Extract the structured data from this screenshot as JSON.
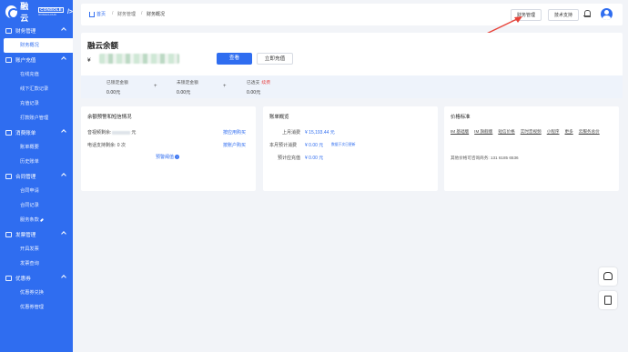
{
  "brand": {
    "name": "融云",
    "console": "CONSOLE",
    "sub": "RONGCLOUD",
    "code": "/>"
  },
  "sidebar": {
    "groups": [
      {
        "label": "财务管理",
        "items": [
          {
            "label": "财务概况",
            "active": true
          }
        ]
      },
      {
        "label": "账户充值",
        "items": [
          {
            "label": "在线充值"
          },
          {
            "label": "线下汇款记录"
          },
          {
            "label": "充值记录"
          },
          {
            "label": "打款账户管理"
          }
        ]
      },
      {
        "label": "消费账单",
        "items": [
          {
            "label": "账单概要"
          },
          {
            "label": "历史账单"
          }
        ]
      },
      {
        "label": "合同管理",
        "items": [
          {
            "label": "合同申请"
          },
          {
            "label": "合同记录"
          },
          {
            "label": "服务条款"
          }
        ]
      },
      {
        "label": "发票管理",
        "items": [
          {
            "label": "开具发票"
          },
          {
            "label": "发票查询"
          }
        ]
      },
      {
        "label": "优惠券",
        "items": [
          {
            "label": "优惠券兑换"
          },
          {
            "label": "优惠券管理"
          }
        ]
      }
    ]
  },
  "header": {
    "home": "首页",
    "sep": "/",
    "crumbs": [
      "财务管理",
      "财务概况"
    ],
    "finance_button": "财务管理",
    "tech_button": "技术支持"
  },
  "balance": {
    "title": "融云余额",
    "currency": "¥",
    "view_button": "查看",
    "recharge_button": "立即充值",
    "stats": [
      {
        "label": "已锁定金额",
        "value": "0.00元"
      },
      {
        "label": "未锁定金额",
        "value": "0.00元"
      },
      {
        "label": "已透支",
        "tag": "续费",
        "value": "0.00元"
      }
    ]
  },
  "card_balance_warning": {
    "title": "余额预警和短信情况",
    "sms_label": "音视频剩余:",
    "sms_unit": "元",
    "sms_link": "按应用购买",
    "phone_label": "电话支持剩余: 0 次",
    "phone_link": "按账户购买",
    "threshold_link": "预警阈值"
  },
  "card_bill": {
    "title": "账单概览",
    "last_month_label": "上月消费",
    "last_month_value": "¥ 15,193.44 元",
    "this_month_label": "本月预计消费",
    "this_month_value": "¥ 0.00 元",
    "this_month_note": "数据于次日更新",
    "prepaid_label": "预计应充值",
    "prepaid_value": "¥ 0.00 元"
  },
  "card_price": {
    "title": "价格标准",
    "tags": [
      "IM 基础版",
      "IM 旗舰版",
      "短信价格",
      "实时音视频",
      "小程序",
      "更多"
    ],
    "extra_tag": "云服务总价",
    "contact": "其他价格可咨询商务: 131 6185 6536"
  },
  "widgets": {
    "float1": "support-widget",
    "float2": "feedback-widget"
  }
}
